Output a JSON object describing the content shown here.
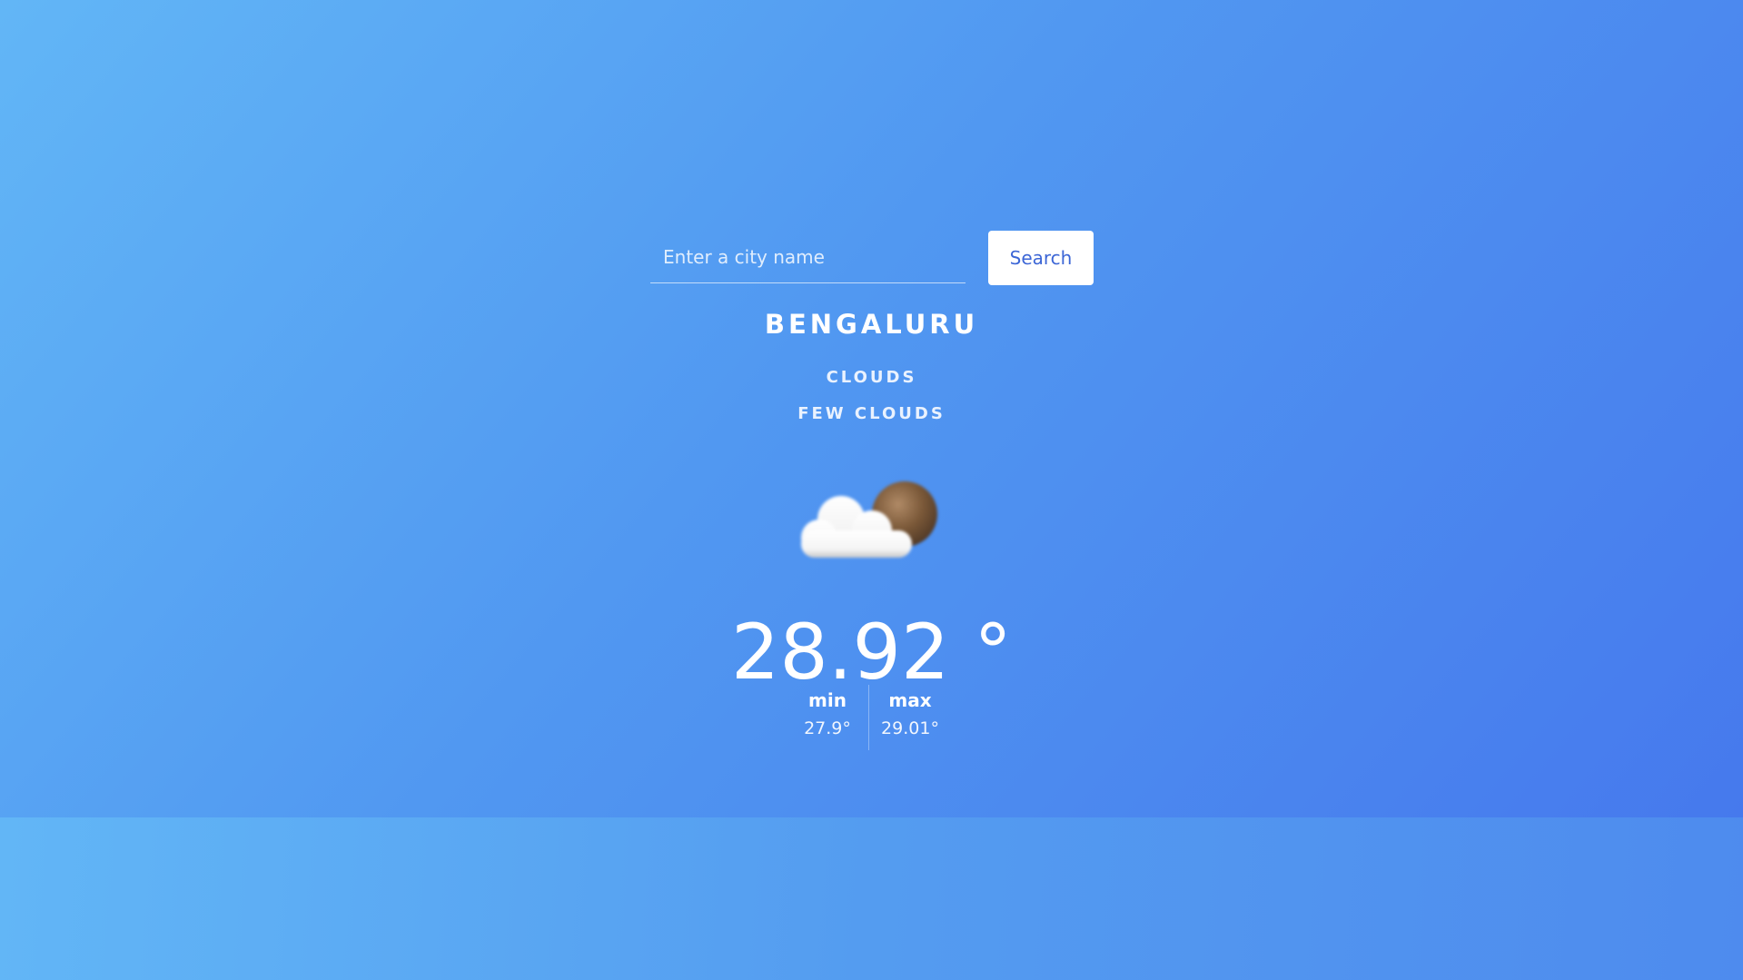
{
  "search": {
    "placeholder": "Enter a city name",
    "value": "",
    "button_label": "Search"
  },
  "weather": {
    "city": "BENGALURU",
    "condition": "CLOUDS",
    "description": "FEW CLOUDS",
    "icon": "few-clouds-icon",
    "temperature": "28.92 °",
    "min_label": "min",
    "min_value": "27.9°",
    "max_label": "max",
    "max_value": "29.01°"
  },
  "colors": {
    "gradient_start": "#62b6f6",
    "gradient_end": "#4679ed",
    "button_text": "#3c66d6"
  }
}
